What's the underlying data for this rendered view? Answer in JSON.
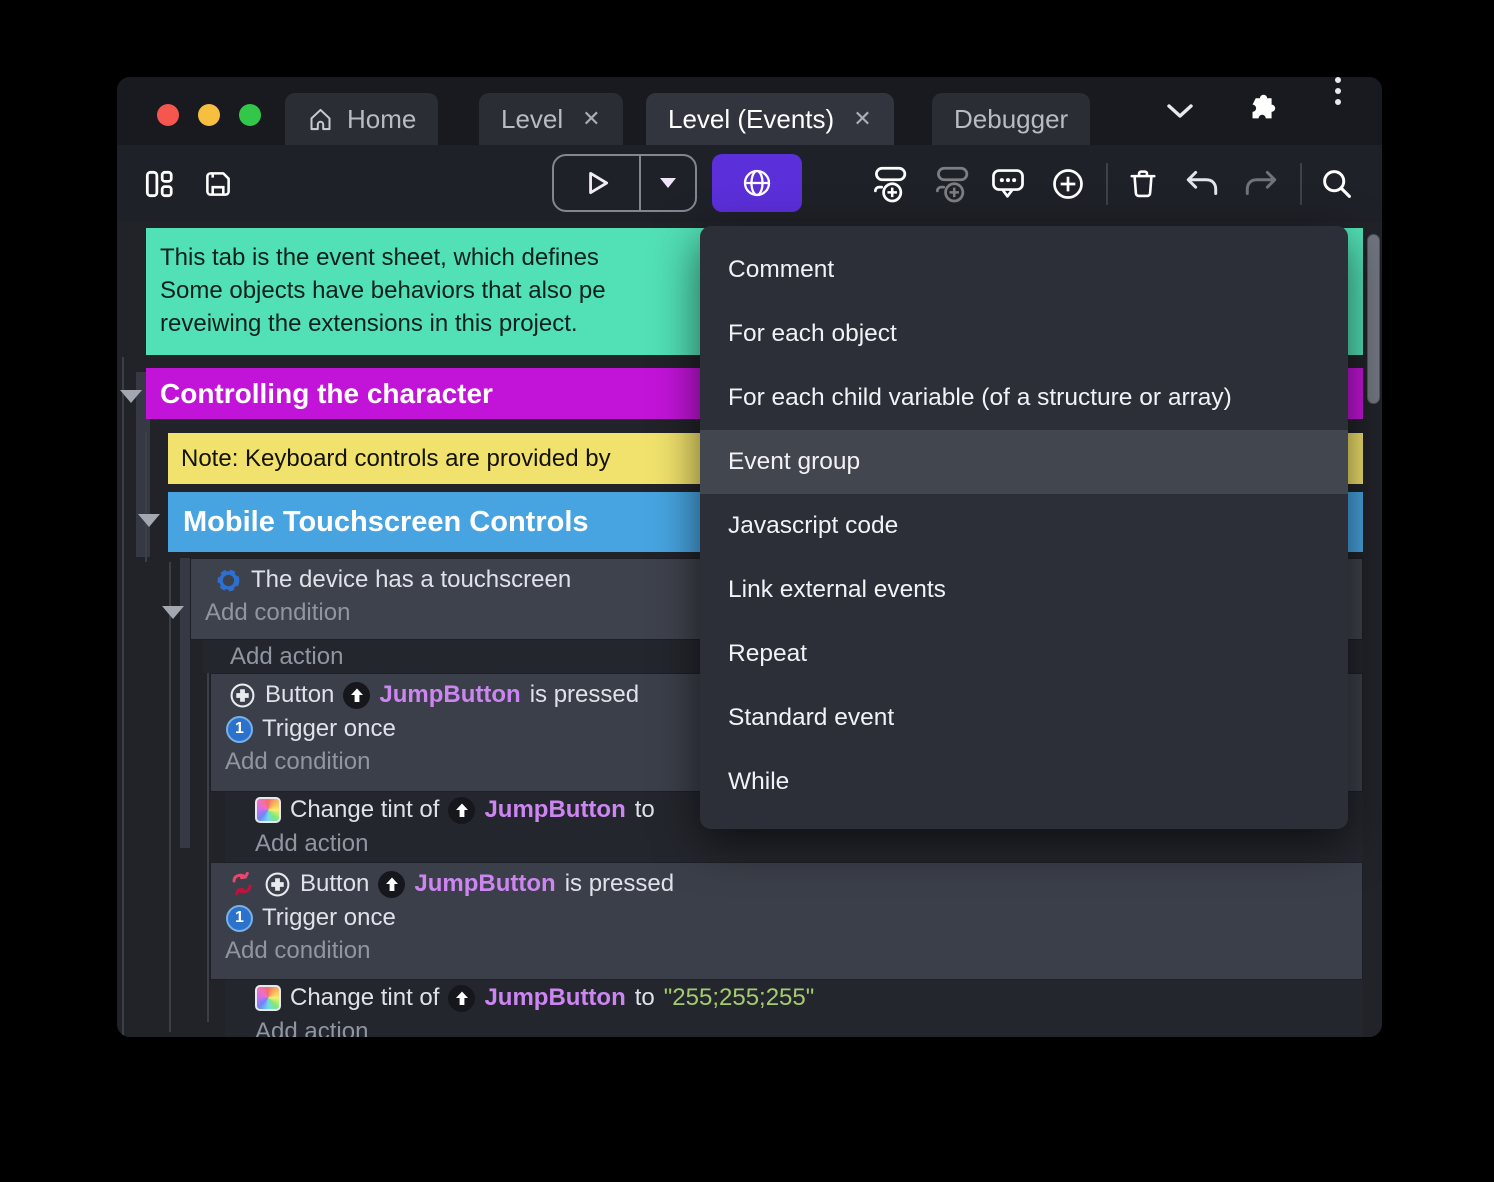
{
  "titlebar": {
    "tabs": [
      {
        "label": "Home"
      },
      {
        "label": "Level"
      },
      {
        "label": "Level (Events)"
      },
      {
        "label": "Debugger"
      }
    ],
    "close_glyph": "✕"
  },
  "toolbar": {
    "accent_color": "#5b2fd9"
  },
  "context_menu": {
    "items": [
      "Comment",
      "For each object",
      "For each child variable (of a structure or array)",
      "Event group",
      "Javascript code",
      "Link external events",
      "Repeat",
      "Standard event",
      "While"
    ],
    "highlighted": "Event group"
  },
  "sheet": {
    "comment": {
      "bg": "#52e0b6",
      "lines": [
        "This tab is the event sheet, which defines",
        "Some objects have behaviors that also pe",
        "reveiwing the extensions in this project."
      ]
    },
    "group_controlling": {
      "label": "Controlling the character",
      "bg": "#c214d8"
    },
    "note": {
      "text": "Note: Keyboard controls are provided by",
      "bg": "#f0e26c"
    },
    "group_mobile": {
      "label": "Mobile Touchscreen Controls",
      "bg": "#47a4e0"
    },
    "labels": {
      "device_touchscreen": "The device has a touchscreen",
      "add_condition": "Add condition",
      "add_action": "Add action",
      "button": "Button",
      "object_name": "JumpButton",
      "is_pressed": "is pressed",
      "trigger_once": "Trigger once",
      "change_tint_of": "Change tint of",
      "to": "to",
      "tint_value": "\"255;255;255\""
    },
    "colors": {
      "object": "#cd85f2",
      "string": "#a3cc6e"
    }
  }
}
